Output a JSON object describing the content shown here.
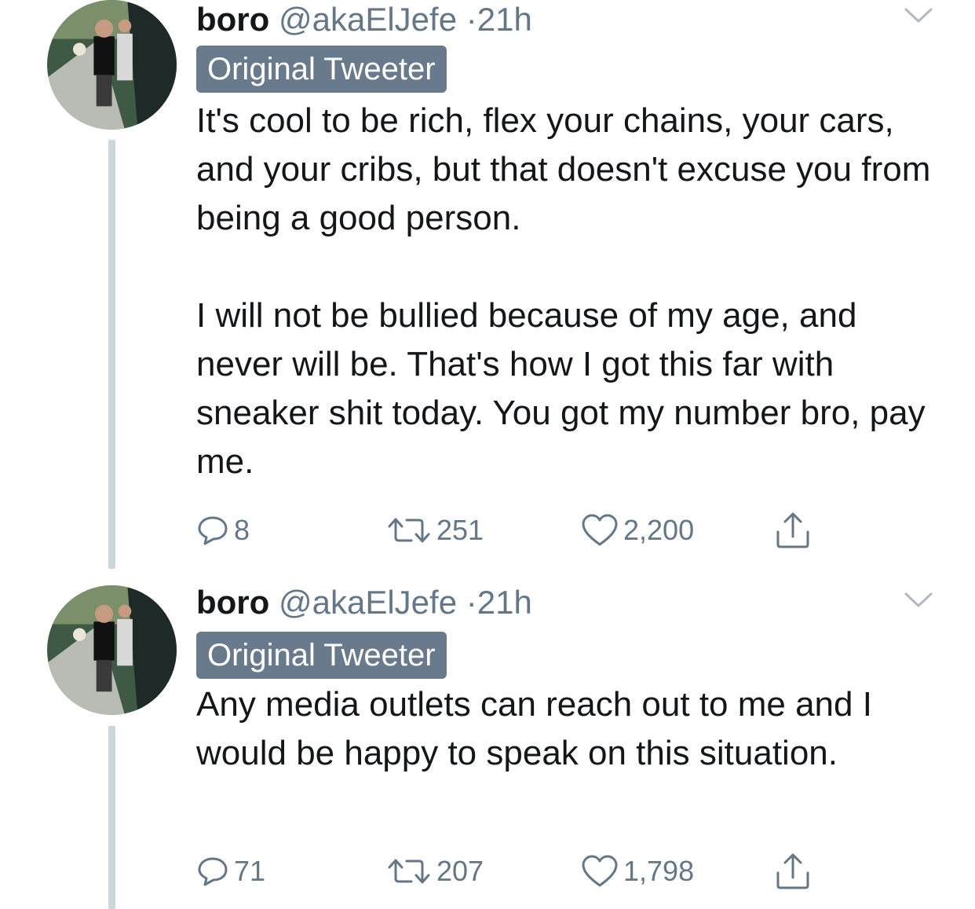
{
  "tweets": [
    {
      "name": "boro",
      "handle": "@akaElJefe",
      "separator": "·",
      "time": "21h",
      "badge": "Original Tweeter",
      "paragraphs": [
        "It's cool to be rich, flex your chains, your cars, and your cribs, but that doesn't excuse you from being a good person.",
        "I will not be bullied because of my age, and never will be. That's how I got this far with sneaker shit today. You got my number bro, pay me."
      ],
      "replies": "8",
      "retweets": "251",
      "likes": "2,200"
    },
    {
      "name": "boro",
      "handle": "@akaElJefe",
      "separator": "·",
      "time": "21h",
      "badge": "Original Tweeter",
      "paragraphs": [
        "Any media outlets can reach out to me and I would be happy to speak on this situation."
      ],
      "replies": "71",
      "retweets": "207",
      "likes": "1,798"
    }
  ],
  "icons": {
    "reply": "reply-icon",
    "retweet": "retweet-icon",
    "like": "heart-icon",
    "share": "share-icon",
    "menu": "chevron-down-icon"
  },
  "colors": {
    "text": "#14171a",
    "secondary": "#657786",
    "badge_bg": "#687a8b",
    "thread_line": "#ccd6dd"
  }
}
